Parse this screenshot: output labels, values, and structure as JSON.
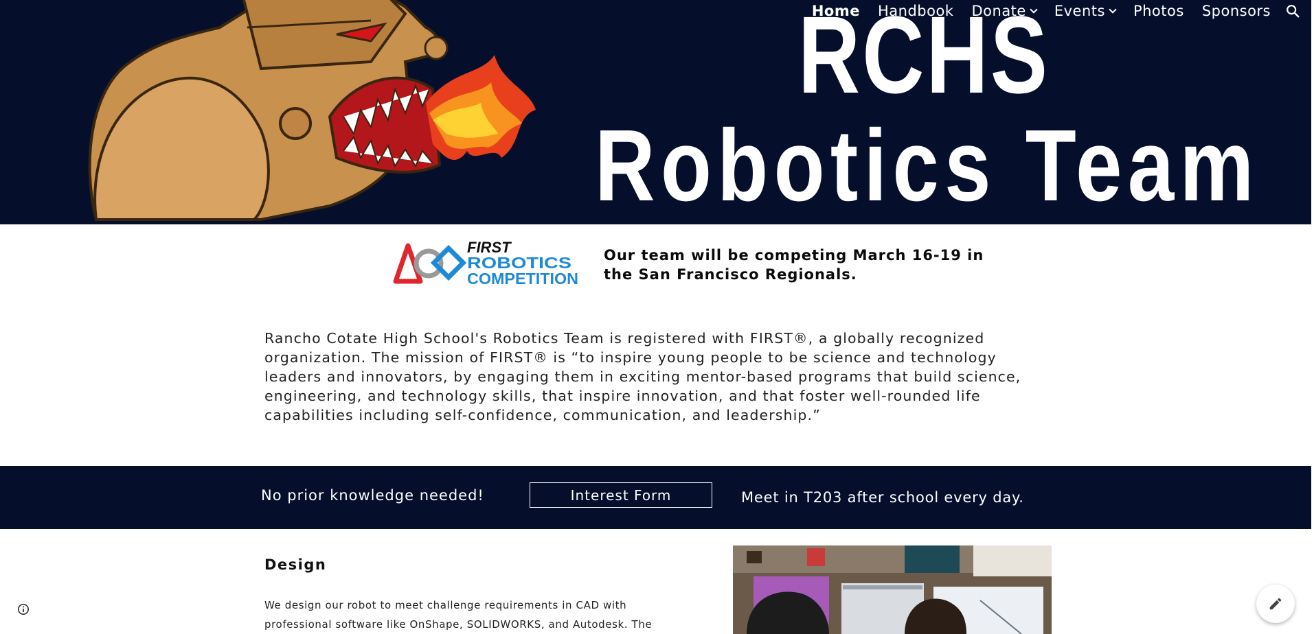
{
  "nav": {
    "items": [
      {
        "label": "Home",
        "active": true,
        "has_dropdown": false
      },
      {
        "label": "Handbook",
        "active": false,
        "has_dropdown": false
      },
      {
        "label": "Donate",
        "active": false,
        "has_dropdown": true
      },
      {
        "label": "Events",
        "active": false,
        "has_dropdown": true
      },
      {
        "label": "Photos",
        "active": false,
        "has_dropdown": false
      },
      {
        "label": "Sponsors",
        "active": false,
        "has_dropdown": false
      }
    ],
    "search_icon": "search-icon"
  },
  "hero": {
    "title_line1": "RCHS",
    "title_line2": "Robotics Team",
    "background_color": "#050f2c"
  },
  "first_logo": {
    "line1": "FIRST",
    "line2": "ROBOTICS",
    "line3": "COMPETITION"
  },
  "announcement": "Our team will be competing March 16-19 in the San Francisco Regionals.",
  "mission": "Rancho Cotate High School's Robotics Team is registered with FIRST®, a globally recognized organization. The mission of FIRST® is “to inspire young people to be science and technology leaders and innovators, by engaging them in exciting mentor-based programs that build science, engineering, and technology skills, that inspire innovation, and that foster well-rounded life capabilities including self-confidence, communication, and leadership.”",
  "band": {
    "left_text": "No prior knowledge needed!",
    "button_label": "Interest Form",
    "right_text": "Meet in T203 after school every day."
  },
  "design": {
    "heading": "Design",
    "text": "We design our robot to meet challenge requirements in CAD with professional software like OnShape, SOLIDWORKS, and Autodesk. The"
  },
  "colors": {
    "navy": "#050f2c",
    "first_red": "#e0262d",
    "first_blue": "#1d8ad6"
  }
}
